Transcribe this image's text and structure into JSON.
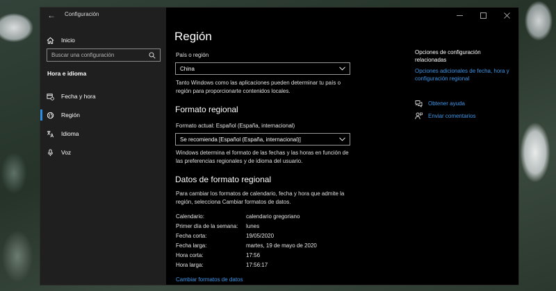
{
  "window": {
    "app_title": "Configuración"
  },
  "sidebar": {
    "home_label": "Inicio",
    "search_placeholder": "Buscar una configuración",
    "section_title": "Hora e idioma",
    "items": [
      {
        "label": "Fecha y hora",
        "icon": "calendar-clock-icon",
        "selected": false
      },
      {
        "label": "Región",
        "icon": "globe-icon",
        "selected": true
      },
      {
        "label": "Idioma",
        "icon": "language-icon",
        "selected": false
      },
      {
        "label": "Voz",
        "icon": "microphone-icon",
        "selected": false
      }
    ]
  },
  "main": {
    "title": "Región",
    "country_label": "País o región",
    "country_value": "China",
    "country_desc": [
      "Tanto Windows como las aplicaciones pueden determinar tu país o",
      "región para proporcionarte contenidos locales."
    ],
    "regional_format_heading": "Formato regional",
    "current_format_label": "Formato actual: Español (España, internacional)",
    "format_dropdown_value": "Se recomienda [Español (España, internacional)]",
    "format_desc": [
      "Windows determina el formato de las fechas y las horas en función de",
      "las preferencias regionales y de idioma del usuario."
    ],
    "data_heading": "Datos de formato regional",
    "data_desc": [
      "Para cambiar los formatos de calendario, fecha y hora que admite la",
      "región, selecciona Cambiar formatos de datos."
    ],
    "data_rows": [
      {
        "key": "Calendario:",
        "value": "calendario gregoriano"
      },
      {
        "key": "Primer día de la semana:",
        "value": "lunes"
      },
      {
        "key": "Fecha corta:",
        "value": "19/05/2020"
      },
      {
        "key": "Fecha larga:",
        "value": "martes, 19 de mayo de 2020"
      },
      {
        "key": "Hora corta:",
        "value": "17:56"
      },
      {
        "key": "Hora larga:",
        "value": "17:56:17"
      }
    ],
    "change_formats_link": "Cambiar formatos de datos"
  },
  "related": {
    "title": [
      "Opciones de configuración",
      "relacionadas"
    ],
    "link": [
      "Opciones adicionales de fecha, hora y",
      "configuración regional"
    ],
    "help_label": "Obtener ayuda",
    "feedback_label": "Enviar comentarios"
  },
  "colors": {
    "accent": "#2b8fe6",
    "link": "#3c96e8",
    "sidebar_bg": "#1f1f1f",
    "content_bg": "#000000"
  }
}
